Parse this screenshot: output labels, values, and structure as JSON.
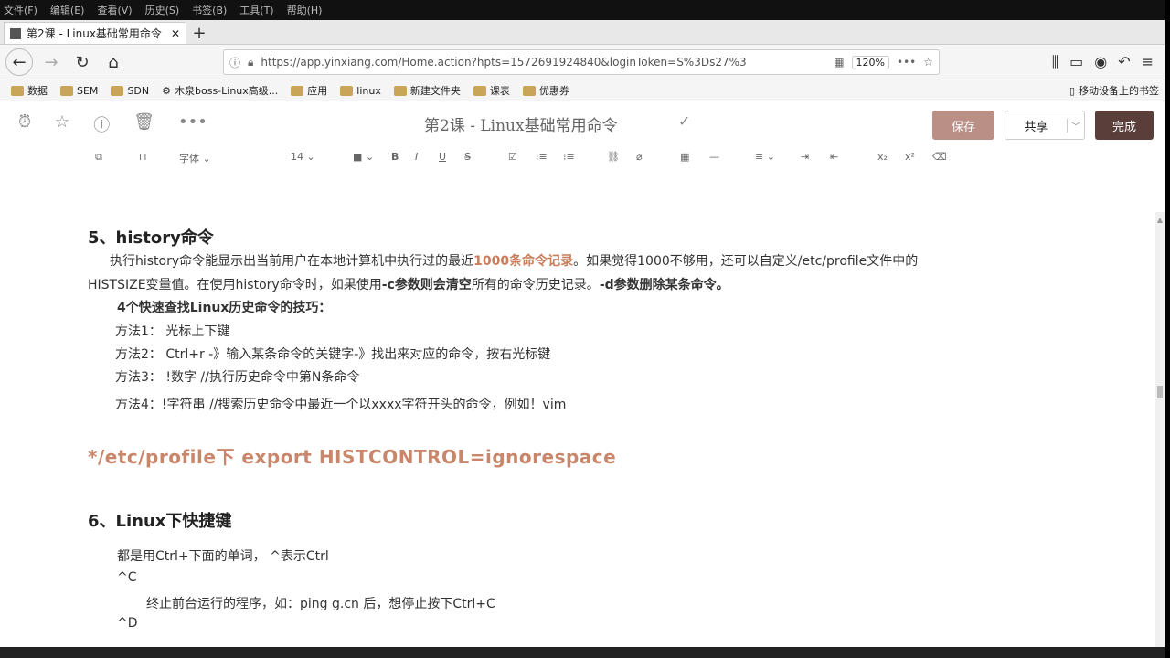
{
  "menu": [
    "文件(F)",
    "编辑(E)",
    "查看(V)",
    "历史(S)",
    "书签(B)",
    "工具(T)",
    "帮助(H)"
  ],
  "tab": {
    "title": "第2课 - Linux基础常用命令 | 印"
  },
  "url": "https://app.yinxiang.com/Home.action?hpts=1572691924840&loginToken=S%3Ds27%3",
  "zoom": "120%",
  "bookmarks": [
    "数据",
    "SEM",
    "SDN",
    "木泉boss-Linux高级...",
    "应用",
    "linux",
    "新建文件夹",
    "课表",
    "优惠券"
  ],
  "bookmark_right": "移动设备上的书签",
  "note": {
    "title": "第2课 - Linux基础常用命令",
    "save": "保存",
    "share": "共享",
    "done": "完成"
  },
  "toolbar": {
    "font": "字体",
    "size": "14"
  },
  "content": {
    "s5_title": "5、history命令",
    "p1a": "执行history命令能显示出当前用户在本地计算机中执行过的最近",
    "p1b": "1000条命令记录",
    "p1c": "。如果觉得1000不够用，还可以自定义/etc/profile文件中的",
    "p2a": "HISTSIZE变量值。在使用history命令时，如果使用",
    "p2b": "-c参数则会清空",
    "p2c": "所有的命令历史记录。",
    "p2d": "-d参数删除某条命令。",
    "tips_title": "4个快速查找Linux历史命令的技巧：",
    "m1": "方法1：  光标上下键",
    "m2": "方法2：  Ctrl+r -》输入某条命令的关键字-》找出来对应的命令，按右光标键",
    "m3": "方法3：  !数字 //执行历史命令中第N条命令",
    "m4": "方法4：!字符串 //搜索历史命令中最近一个以xxxx字符开头的命令，例如！vim",
    "export": "*/etc/profile下 export   HISTCONTROL=ignorespace",
    "s6_title": "6、Linux下快捷键",
    "k1": "都是用Ctrl+下面的单词，  ^表示Ctrl",
    "k2": "^C",
    "k3": "终止前台运行的程序，如：ping g.cn 后，想停止按下Ctrl+C",
    "k4": "^D"
  }
}
